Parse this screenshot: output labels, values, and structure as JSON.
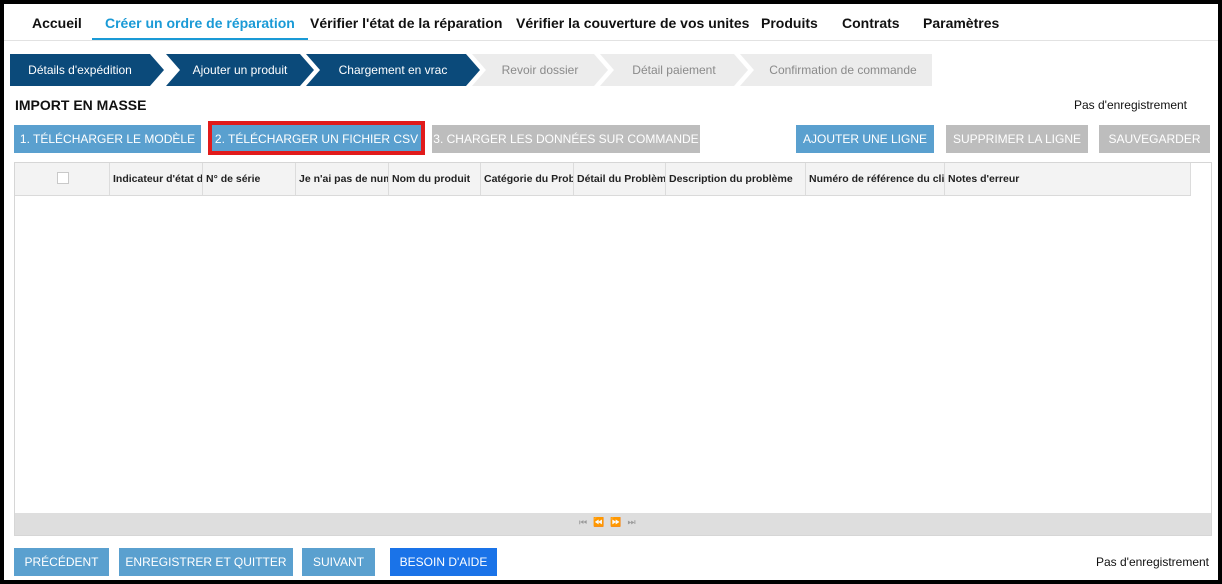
{
  "nav": {
    "items": [
      {
        "label": "Accueil"
      },
      {
        "label": "Créer un ordre de réparation"
      },
      {
        "label": "Vérifier l'état de la réparation"
      },
      {
        "label": "Vérifier la couverture de vos unites"
      },
      {
        "label": "Produits"
      },
      {
        "label": "Contrats"
      },
      {
        "label": "Paramètres"
      }
    ]
  },
  "steps": [
    {
      "label": "Détails d'expédition",
      "state": "done"
    },
    {
      "label": "Ajouter un produit",
      "state": "done"
    },
    {
      "label": "Chargement en vrac",
      "state": "done"
    },
    {
      "label": "Revoir dossier",
      "state": "todo"
    },
    {
      "label": "Détail paiement",
      "state": "todo"
    },
    {
      "label": "Confirmation de commande",
      "state": "todo"
    }
  ],
  "section_title": "IMPORT EN MASSE",
  "status_text": "Pas d'enregistrement",
  "toolbar": {
    "download_template": "1. TÉLÉCHARGER LE MODÈLE",
    "upload_csv": "2. TÉLÉCHARGER UN FICHIER CSV",
    "load_data": "3. CHARGER LES DONNÉES SUR COMMANDE",
    "add_row": "AJOUTER UNE LIGNE",
    "delete_row": "SUPPRIMER LA LIGNE",
    "save": "SAUVEGARDER"
  },
  "grid": {
    "columns": [
      "Indicateur d'état du produit",
      "N° de série",
      "Je n'ai pas de numéro de série",
      "Nom du produit",
      "Catégorie du Problème",
      "Détail du Problème",
      "Description du problème",
      "Numéro de référence du client",
      "Notes d'erreur"
    ],
    "pager_icons": [
      "first-page-icon",
      "prev-page-icon",
      "next-page-icon",
      "last-page-icon"
    ]
  },
  "footer": {
    "previous": "PRÉCÉDENT",
    "save_quit": "ENREGISTRER ET QUITTER",
    "next": "SUIVANT",
    "help": "BESOIN D'AIDE"
  },
  "colors": {
    "accent": "#1a9ad6",
    "step_done": "#0b4a7a",
    "button_blue": "#5aa0cf",
    "button_disabled": "#bdbdbd",
    "help_button": "#1a73e8",
    "highlight": "#e11b1b"
  }
}
